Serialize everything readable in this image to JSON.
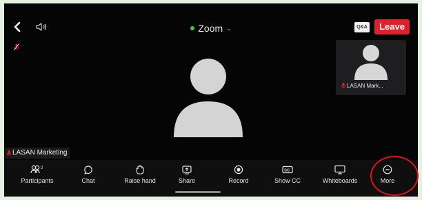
{
  "header": {
    "back_icon": "chevron-left-icon",
    "speaker_icon": "speaker-icon",
    "title": "Zoom",
    "title_status_color": "#2ed158",
    "qa_label": "Q&A",
    "leave_label": "Leave",
    "leave_color": "#e0212b"
  },
  "self_view": {
    "name": "LASAN Mark..."
  },
  "active_speaker": {
    "name": "LASAN Marketing"
  },
  "toolbar": {
    "items": [
      {
        "label": "Participants",
        "icon": "participants-icon",
        "count": "2"
      },
      {
        "label": "Chat",
        "icon": "chat-icon"
      },
      {
        "label": "Raise hand",
        "icon": "raise-hand-icon"
      },
      {
        "label": "Share",
        "icon": "share-icon"
      },
      {
        "label": "Record",
        "icon": "record-icon"
      },
      {
        "label": "Show CC",
        "icon": "closed-captions-icon"
      },
      {
        "label": "Whiteboards",
        "icon": "whiteboard-icon"
      },
      {
        "label": "More",
        "icon": "more-icon"
      }
    ]
  }
}
